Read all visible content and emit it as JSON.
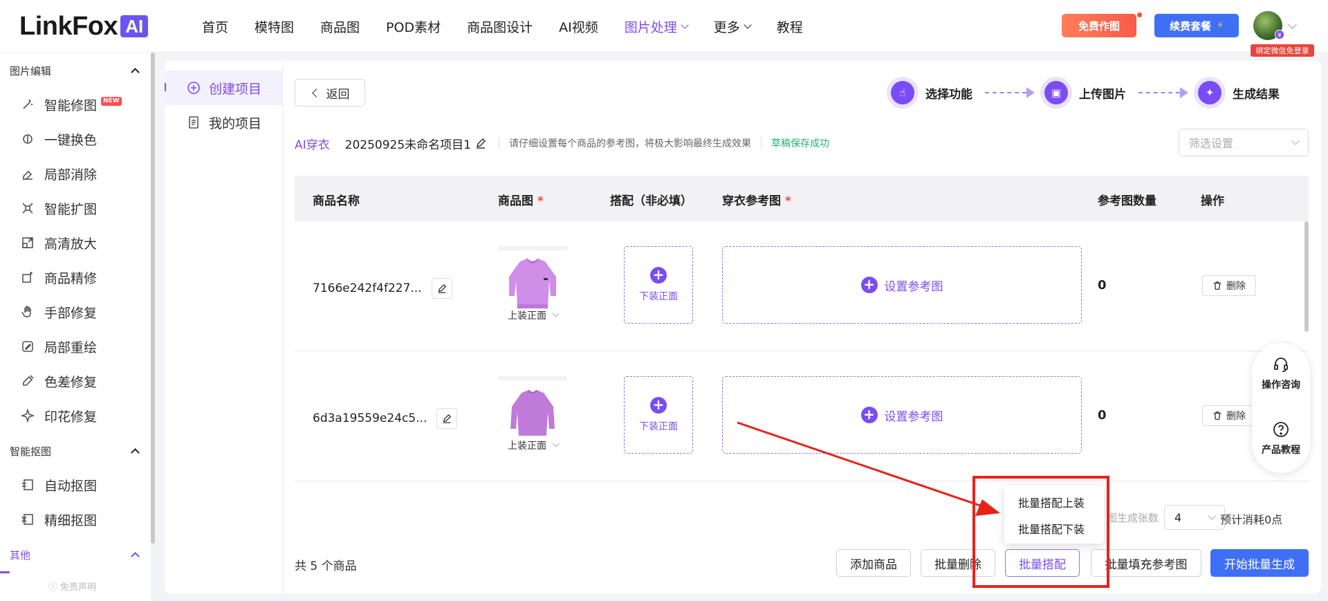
{
  "header": {
    "logo_text": "LinkFox",
    "logo_badge": "AI",
    "menu": [
      {
        "label": "首页"
      },
      {
        "label": "模特图"
      },
      {
        "label": "商品图"
      },
      {
        "label": "POD素材"
      },
      {
        "label": "商品图设计"
      },
      {
        "label": "AI视频"
      },
      {
        "label": "图片处理"
      },
      {
        "label": "更多"
      },
      {
        "label": "教程"
      }
    ],
    "free_btn": "免费作图",
    "renew_btn": "续费套餐",
    "wx_tag": "绑定微信免登录"
  },
  "sidebar": {
    "group1": "图片编辑",
    "items1": [
      "智能修图",
      "一键换色",
      "局部消除",
      "智能扩图",
      "高清放大",
      "商品精修",
      "手部修复",
      "局部重绘",
      "色差修复",
      "印花修复"
    ],
    "new_tag": "NEW",
    "group2": "智能抠图",
    "items2": [
      "自动抠图",
      "精细抠图"
    ],
    "group3": "其他",
    "footer": "免责声明"
  },
  "subnav": {
    "create": "创建项目",
    "mine": "我的项目"
  },
  "toolbar": {
    "back": "返回",
    "steps": [
      "选择功能",
      "上传图片",
      "生成结果"
    ],
    "tag": "AI穿衣",
    "project_name": "20250925未命名项目1",
    "hint": "请仔细设置每个商品的参考图，将极大影响最终生成效果",
    "saved": "草稿保存成功",
    "filter_placeholder": "筛选设置"
  },
  "table": {
    "headers": {
      "name": "商品名称",
      "image": "商品图",
      "match": "搭配（非必填）",
      "ref": "穿衣参考图",
      "count": "参考图数量",
      "ops": "操作"
    },
    "rows": [
      {
        "name": "7166e242f4f227...",
        "image_caption": "上装正面",
        "match_label": "下装正面",
        "ref_label": "设置参考图",
        "count": "0",
        "delete": "删除"
      },
      {
        "name": "6d3a19559e24c5...",
        "image_caption": "上装正面",
        "match_label": "下装正面",
        "ref_label": "设置参考图",
        "count": "0",
        "delete": "删除"
      }
    ]
  },
  "float_help": {
    "consult": "操作咨询",
    "tutorial": "产品教程"
  },
  "footer": {
    "total": "共 5 个商品",
    "gen_count_label": "图生成张数",
    "gen_count_value": "4",
    "estimate": "预计消耗0点",
    "add": "添加商品",
    "batch_delete": "批量删除",
    "batch_match": "批量搭配",
    "batch_fill": "批量填充参考图",
    "start": "开始批量生成"
  },
  "dropdown": {
    "top": "批量搭配上装",
    "bottom": "批量搭配下装"
  },
  "colors": {
    "accent": "#7a4cf5",
    "primary": "#3f6ff5",
    "annotation": "#e8221b"
  }
}
